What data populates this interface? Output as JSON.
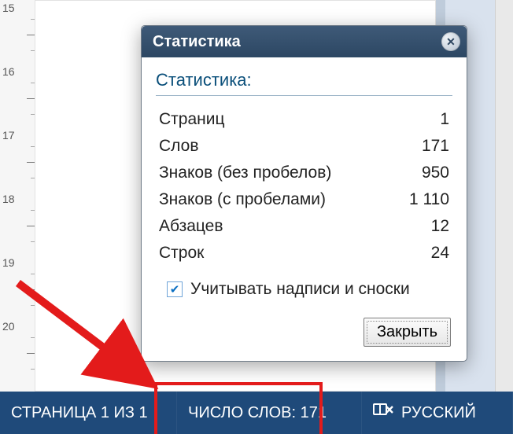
{
  "ruler": {
    "marks": [
      "15",
      "16",
      "17",
      "18",
      "19",
      "20"
    ]
  },
  "dialog": {
    "title": "Статистика",
    "section_title": "Статистика:",
    "rows": [
      {
        "label": "Страниц",
        "value": "1"
      },
      {
        "label": "Слов",
        "value": "171"
      },
      {
        "label": "Знаков (без пробелов)",
        "value": "950"
      },
      {
        "label": "Знаков (с пробелами)",
        "value": "1 110"
      },
      {
        "label": "Абзацев",
        "value": "12"
      },
      {
        "label": "Строк",
        "value": "24"
      }
    ],
    "checkbox_label": "Учитывать надписи и сноски",
    "close_button": "Закрыть"
  },
  "statusbar": {
    "page": "СТРАНИЦА 1 ИЗ 1",
    "words": "ЧИСЛО СЛОВ: 171",
    "language": "РУССКИЙ"
  }
}
